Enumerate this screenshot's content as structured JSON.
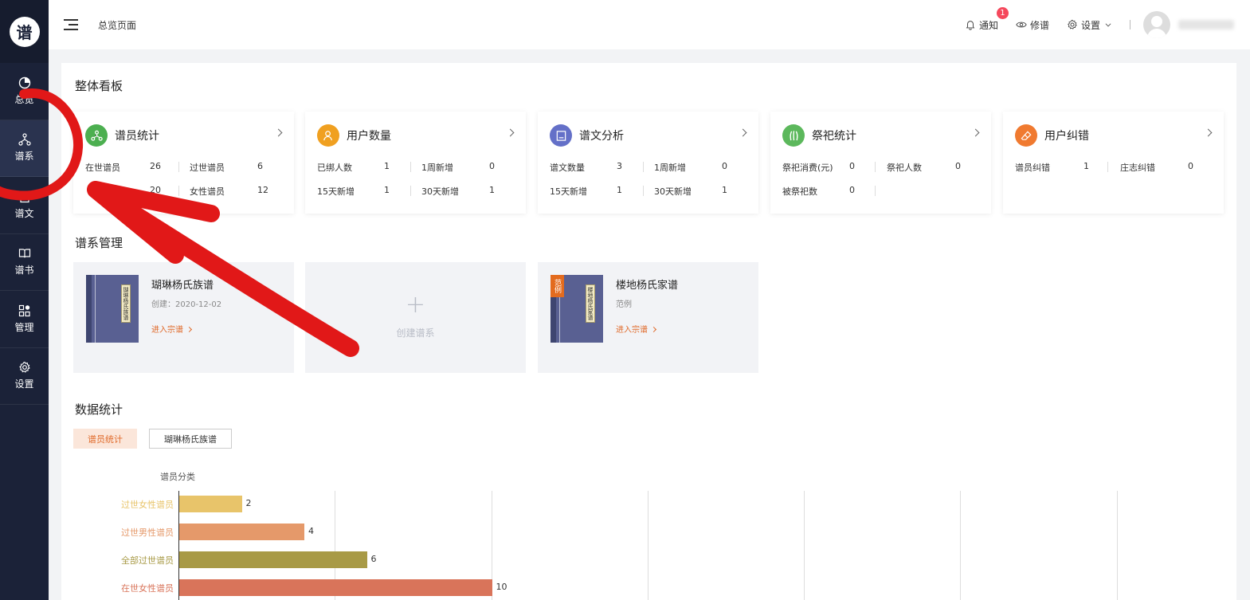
{
  "sidebar": {
    "logo_text": "谱",
    "items": [
      {
        "label": "总览",
        "icon": "pie-chart-icon"
      },
      {
        "label": "谱系",
        "icon": "tree-icon"
      },
      {
        "label": "谱文",
        "icon": "document-icon"
      },
      {
        "label": "谱书",
        "icon": "book-icon"
      },
      {
        "label": "管理",
        "icon": "grid-icon"
      },
      {
        "label": "设置",
        "icon": "gear-icon"
      }
    ]
  },
  "header": {
    "breadcrumb": "总览页面",
    "notify_label": "通知",
    "notify_count": "1",
    "edit_label": "修谱",
    "settings_label": "设置"
  },
  "overview": {
    "title": "整体看板",
    "cards": [
      {
        "title": "谱员统计",
        "color": "#4caf50",
        "rows": [
          [
            {
              "label": "在世谱员",
              "value": "26"
            },
            {
              "label": "过世谱员",
              "value": "6"
            }
          ],
          [
            {
              "label": "",
              "value": "20"
            },
            {
              "label": "女性谱员",
              "value": "12"
            }
          ]
        ]
      },
      {
        "title": "用户数量",
        "color": "#f0a020",
        "rows": [
          [
            {
              "label": "已绑人数",
              "value": "1"
            },
            {
              "label": "1周新增",
              "value": "0"
            }
          ],
          [
            {
              "label": "15天新增",
              "value": "1"
            },
            {
              "label": "30天新增",
              "value": "1"
            }
          ]
        ]
      },
      {
        "title": "谱文分析",
        "color": "#6470c8",
        "rows": [
          [
            {
              "label": "谱文数量",
              "value": "3"
            },
            {
              "label": "1周新增",
              "value": "0"
            }
          ],
          [
            {
              "label": "15天新增",
              "value": "1"
            },
            {
              "label": "30天新增",
              "value": "1"
            }
          ]
        ]
      },
      {
        "title": "祭祀统计",
        "color": "#5cb85c",
        "rows": [
          [
            {
              "label": "祭祀消费(元)",
              "value": "0"
            },
            {
              "label": "祭祀人数",
              "value": "0"
            }
          ],
          [
            {
              "label": "被祭祀数",
              "value": "0"
            },
            {
              "label": "",
              "value": ""
            }
          ]
        ]
      },
      {
        "title": "用户纠错",
        "color": "#f07a30",
        "rows": [
          [
            {
              "label": "谱员纠错",
              "value": "1"
            },
            {
              "label": "庄志纠错",
              "value": "0"
            }
          ]
        ]
      }
    ]
  },
  "genealogy": {
    "title": "谱系管理",
    "cards": [
      {
        "name": "瑚琳杨氏族谱",
        "sub": "创建：2020-12-02",
        "link": "进入宗谱",
        "spine": "瑚琳杨氏族谱"
      },
      {
        "name": "楼地杨氏家谱",
        "sub": "范例",
        "link": "进入宗谱",
        "spine": "楼地杨氏家谱",
        "tag": "范例"
      }
    ],
    "create_label": "创建谱系",
    "create_plus": "+"
  },
  "stats": {
    "title": "数据统计",
    "tabs": [
      "谱员统计",
      "瑚琳杨氏族谱"
    ]
  },
  "chart_data": {
    "type": "bar",
    "title": "谱员分类",
    "orientation": "horizontal",
    "categories": [
      "过世女性谱员",
      "过世男性谱员",
      "全部过世谱员",
      "在世女性谱员"
    ],
    "values": [
      2,
      4,
      6,
      10
    ],
    "colors": [
      "#e8c46a",
      "#e5996a",
      "#a89a46",
      "#d9745a"
    ],
    "xlim": [
      0,
      30
    ],
    "grid": true
  }
}
